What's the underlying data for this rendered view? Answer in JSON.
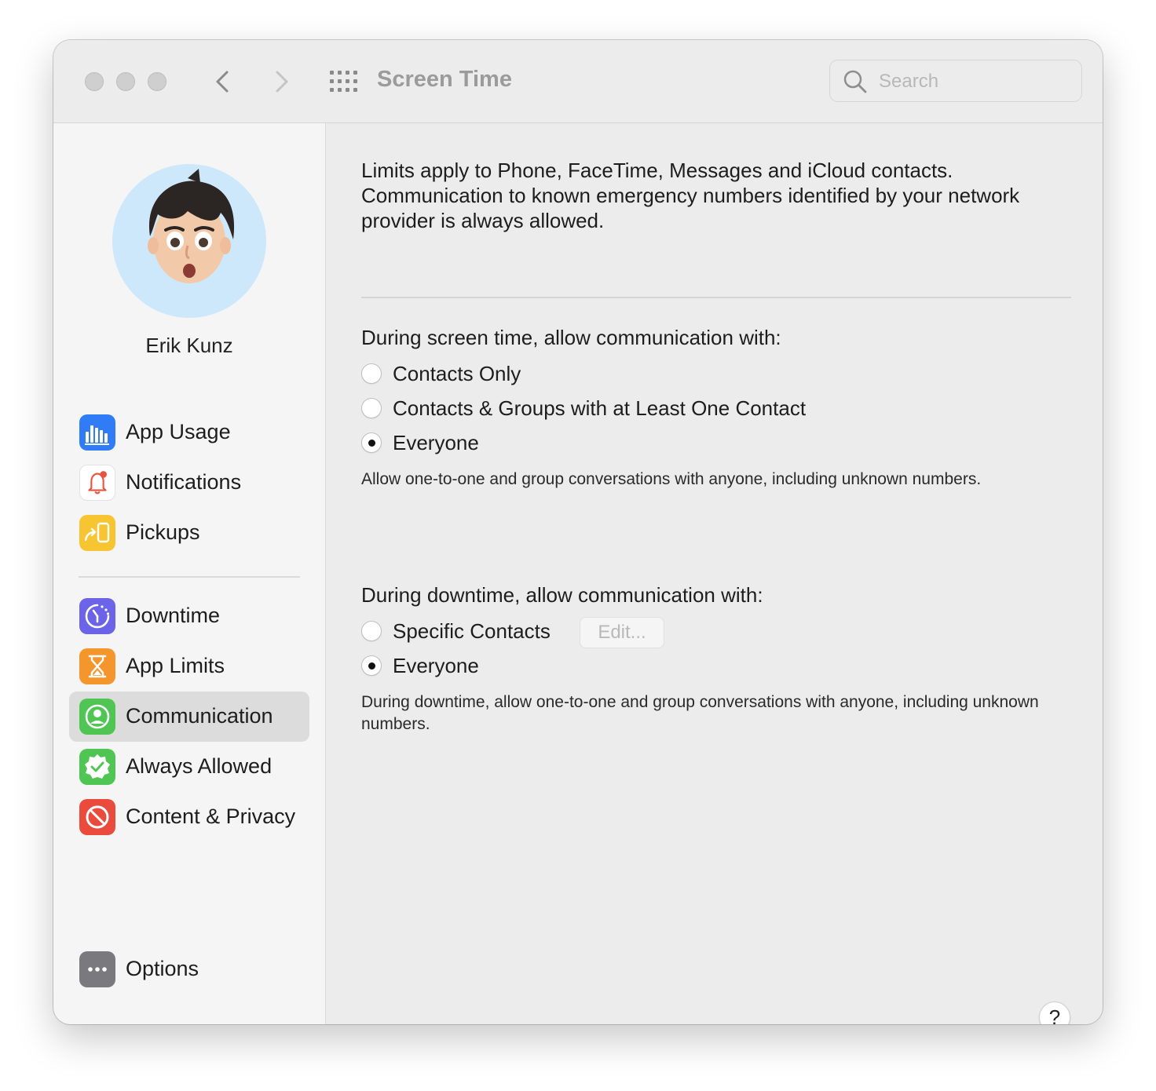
{
  "window": {
    "title": "Screen Time",
    "search": {
      "placeholder": "Search",
      "value": ""
    }
  },
  "sidebar": {
    "user_name": "Erik Kunz",
    "items": [
      {
        "label": "App Usage",
        "icon": "app-usage-icon",
        "color": "#2f7cf6"
      },
      {
        "label": "Notifications",
        "icon": "notifications-bell-icon",
        "color": "#ffffff"
      },
      {
        "label": "Pickups",
        "icon": "pickups-icon",
        "color": "#f7c531"
      },
      {
        "label": "Downtime",
        "icon": "downtime-icon",
        "color": "#6b63e8"
      },
      {
        "label": "App Limits",
        "icon": "hourglass-icon",
        "color": "#f5962c"
      },
      {
        "label": "Communication",
        "icon": "communication-person-icon",
        "color": "#4fc553",
        "selected": true
      },
      {
        "label": "Always Allowed",
        "icon": "checkmark-seal-icon",
        "color": "#4fc553"
      },
      {
        "label": "Content & Privacy",
        "icon": "restricted-icon",
        "color": "#ea4b3c"
      }
    ],
    "options_label": "Options"
  },
  "main": {
    "intro": "Limits apply to Phone, FaceTime, Messages and iCloud contacts. Communication to known emergency numbers identified by your network provider is always allowed.",
    "screen_time": {
      "heading": "During screen time, allow communication with:",
      "options": [
        "Contacts Only",
        "Contacts & Groups with at Least One Contact",
        "Everyone"
      ],
      "selected": "Everyone",
      "note": "Allow one-to-one and group conversations with anyone, including unknown numbers."
    },
    "downtime": {
      "heading": "During downtime, allow communication with:",
      "options": [
        "Specific Contacts",
        "Everyone"
      ],
      "selected": "Everyone",
      "edit_label": "Edit...",
      "note": "During downtime, allow one-to-one and group conversations with anyone, including unknown numbers."
    },
    "help_label": "?"
  }
}
